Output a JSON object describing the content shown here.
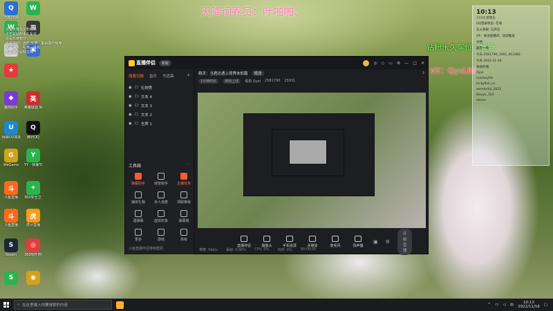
{
  "overlay": {
    "title_text": "天降词养员：叶啪啪、",
    "side_line1": "钻粉永久车位：属管",
    "side_line2": "VX：QyxL88"
  },
  "desktop_icons": [
    {
      "label": "2581790",
      "color": "#2b6fd6",
      "glyph": "Q"
    },
    {
      "label": "",
      "color": "#2bb34f",
      "glyph": "W"
    },
    {
      "label": "",
      "color": "#2bb34f",
      "glyph": "W"
    },
    {
      "label": "",
      "color": "#3a3a3a",
      "glyph": "▦"
    },
    {
      "label": "",
      "color": "#d6d6d6",
      "glyph": "✈"
    },
    {
      "label": "",
      "color": "#3b6bd6",
      "glyph": "▣"
    },
    {
      "label": "",
      "color": "#e33c3c",
      "glyph": "★"
    },
    {
      "label": "魔刻助手",
      "color": "#7b3ad6",
      "glyph": "◆"
    },
    {
      "label": "英雄联盟 WeGame",
      "color": "#c9302c",
      "glyph": "英"
    },
    {
      "label": "网易UU加速器",
      "color": "#1a87d6",
      "glyph": "U"
    },
    {
      "label": "腾讯QQ",
      "color": "#111111",
      "glyph": "Q"
    },
    {
      "label": "WeGame",
      "color": "#d6a11a",
      "glyph": "G"
    },
    {
      "label": "YY - 快播节",
      "color": "#2bb34f",
      "glyph": "Y"
    },
    {
      "label": "斗鱼直播",
      "color": "#ff6a1a",
      "glyph": "斗"
    },
    {
      "label": "360安全卫士",
      "color": "#2bb34f",
      "glyph": "+"
    },
    {
      "label": "斗鱼直播",
      "color": "#ff6a1a",
      "glyph": "斗"
    },
    {
      "label": "虎牙直播",
      "color": "#ff9a1a",
      "glyph": "虎"
    },
    {
      "label": "Steam",
      "color": "#1b2838",
      "glyph": "S"
    },
    {
      "label": "360软件管家",
      "color": "#e33c3c",
      "glyph": "◎"
    },
    {
      "label": "",
      "color": "#2bb34f",
      "glyph": "S"
    },
    {
      "label": "",
      "color": "#d6a11a",
      "glyph": "◉"
    }
  ],
  "desktop_notes": [
    "这是天降永久粉名单",
    "这里是钻粉永久车位",
    "这是年度积分：",
    "这是活动：连胜/完赛，勤战脉升级等",
    "这是抽奖：礼物，道具",
    "这是特别说明文档"
  ],
  "app": {
    "name": "直播伴侣",
    "version_badge": "新版",
    "left_tabs": [
      "场景切换",
      "音乐",
      "写道具"
    ],
    "active_tab_index": 0,
    "scenes": [
      "礼物秀",
      "文本 4",
      "文本 3",
      "文本 2",
      "全屏 1"
    ],
    "tools_title": "工具箱",
    "tools": [
      {
        "label": "弹幕助手",
        "hot": true
      },
      {
        "label": "房管助手",
        "hot": false
      },
      {
        "label": "主播任务",
        "hot": true
      },
      {
        "label": "抽奖礼物",
        "hot": false
      },
      {
        "label": "多人连麦",
        "hot": false
      },
      {
        "label": "领取等级",
        "hot": false
      },
      {
        "label": "语弹幕",
        "hot": false
      },
      {
        "label": "虚拟形象",
        "hot": false
      },
      {
        "label": "弹幕墙",
        "hot": false
      },
      {
        "label": "更多",
        "hot": false
      },
      {
        "label": "游戏",
        "hot": false
      },
      {
        "label": "高级",
        "hot": false
      }
    ],
    "info_line": "精灵：当君达遇上昆界未知篇",
    "info_tag": "修改",
    "stats": [
      "1分钟时长",
      "新粉上线",
      "观看 Qyxl",
      "2581790",
      "25931"
    ],
    "bottom_buttons": [
      "直播伴侣",
      "摄像头",
      "手机投屏",
      "多媒体",
      "麦克风",
      "扬声器"
    ],
    "start_button": "开始直播",
    "status_items": [
      "带宽: 0kb/s",
      "丢帧: 0.00%",
      "CPU: 0%",
      "内存: 0%",
      "00:00:00"
    ],
    "footer_link": "斗鱼直播伴侣使用帮助"
  },
  "right_panel": {
    "time": "10:13",
    "date": "11/18  星期五",
    "rows": [
      "QQ登录状态: 在线",
      "天火系统: 已开启",
      "VX：关注直播间，动态推送",
      "文档",
      "最近一周",
      "今天  2581790_1002_413380",
      "今天  2022-11-16",
      "本地存储",
      "Qyxl",
      "monkeyfilz",
      "luckyfish_vv",
      "wonderful_2022",
      "Douyu_123",
      "steam"
    ]
  },
  "taskbar": {
    "search_placeholder": "在这里输入你要搜索的内容",
    "time": "10:13",
    "date": "2022/11/18",
    "ime": "中"
  },
  "colors": {
    "accent": "#ff7a2b",
    "overlay_pink": "#ff7ab0",
    "overlay_green": "#7dff5a",
    "app_bg": "#1d1e22"
  }
}
